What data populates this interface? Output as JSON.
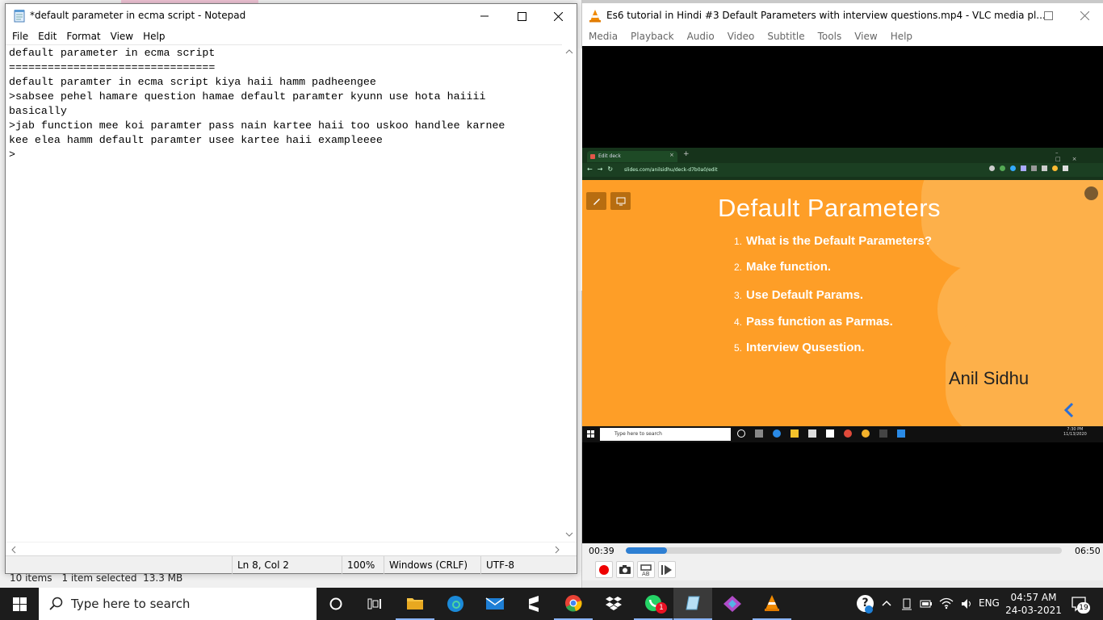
{
  "explorer": {
    "items_count": "10 items",
    "selected": "1 item selected  13.3 MB"
  },
  "notepad": {
    "title": "*default parameter in ecma script - Notepad",
    "menu": [
      "File",
      "Edit",
      "Format",
      "View",
      "Help"
    ],
    "content": "default parameter in ecma script\n================================\ndefault paramter in ecma script kiya haii hamm padheengee\n>sabsee pehel hamare question hamae default paramter kyunn use hota haiiii\nbasically\n>jab function mee koi paramter pass nain kartee haii too uskoo handlee karnee\nkee elea hamm default paramter usee kartee haii exampleeee\n>",
    "status": {
      "position": "Ln 8, Col 2",
      "zoom": "100%",
      "line_ending": "Windows (CRLF)",
      "encoding": "UTF-8"
    }
  },
  "vlc": {
    "title": "Es6 tutorial in Hindi #3  Default Parameters with interview questions.mp4 - VLC media pl...",
    "menu": [
      "Media",
      "Playback",
      "Audio",
      "Video",
      "Subtitle",
      "Tools",
      "View",
      "Help"
    ],
    "time_elapsed": "00:39",
    "time_total": "06:50",
    "progress": 0.095,
    "video": {
      "browser_tab": "Edit deck",
      "url": "slides.com/anilsidhu/deck-d7b0a0/edit",
      "slide_title": "Default Parameters",
      "slide_items": [
        {
          "num": "1.",
          "text": "What is the Default Parameters?"
        },
        {
          "num": "2.",
          "text": "Make function."
        },
        {
          "num": "3.",
          "text": "Use Default Params."
        },
        {
          "num": "4.",
          "text": "Pass function as Parmas."
        },
        {
          "num": "5.",
          "text": "Interview Qusestion."
        }
      ],
      "author": "Anil Sidhu",
      "inner_search_placeholder": "Type here to search",
      "inner_time": "7:30 PM",
      "inner_date": "11/13/2020"
    }
  },
  "taskbar": {
    "search_placeholder": "Type here to search",
    "language": "ENG",
    "time": "04:57 AM",
    "date": "24-03-2021",
    "notification_count": "19",
    "whatsapp_badge": "1"
  },
  "colors": {
    "slide_orange": "#fe9e27",
    "vlc_seek_blue": "#2d7fd3",
    "taskbar": "#1c1c1c"
  }
}
